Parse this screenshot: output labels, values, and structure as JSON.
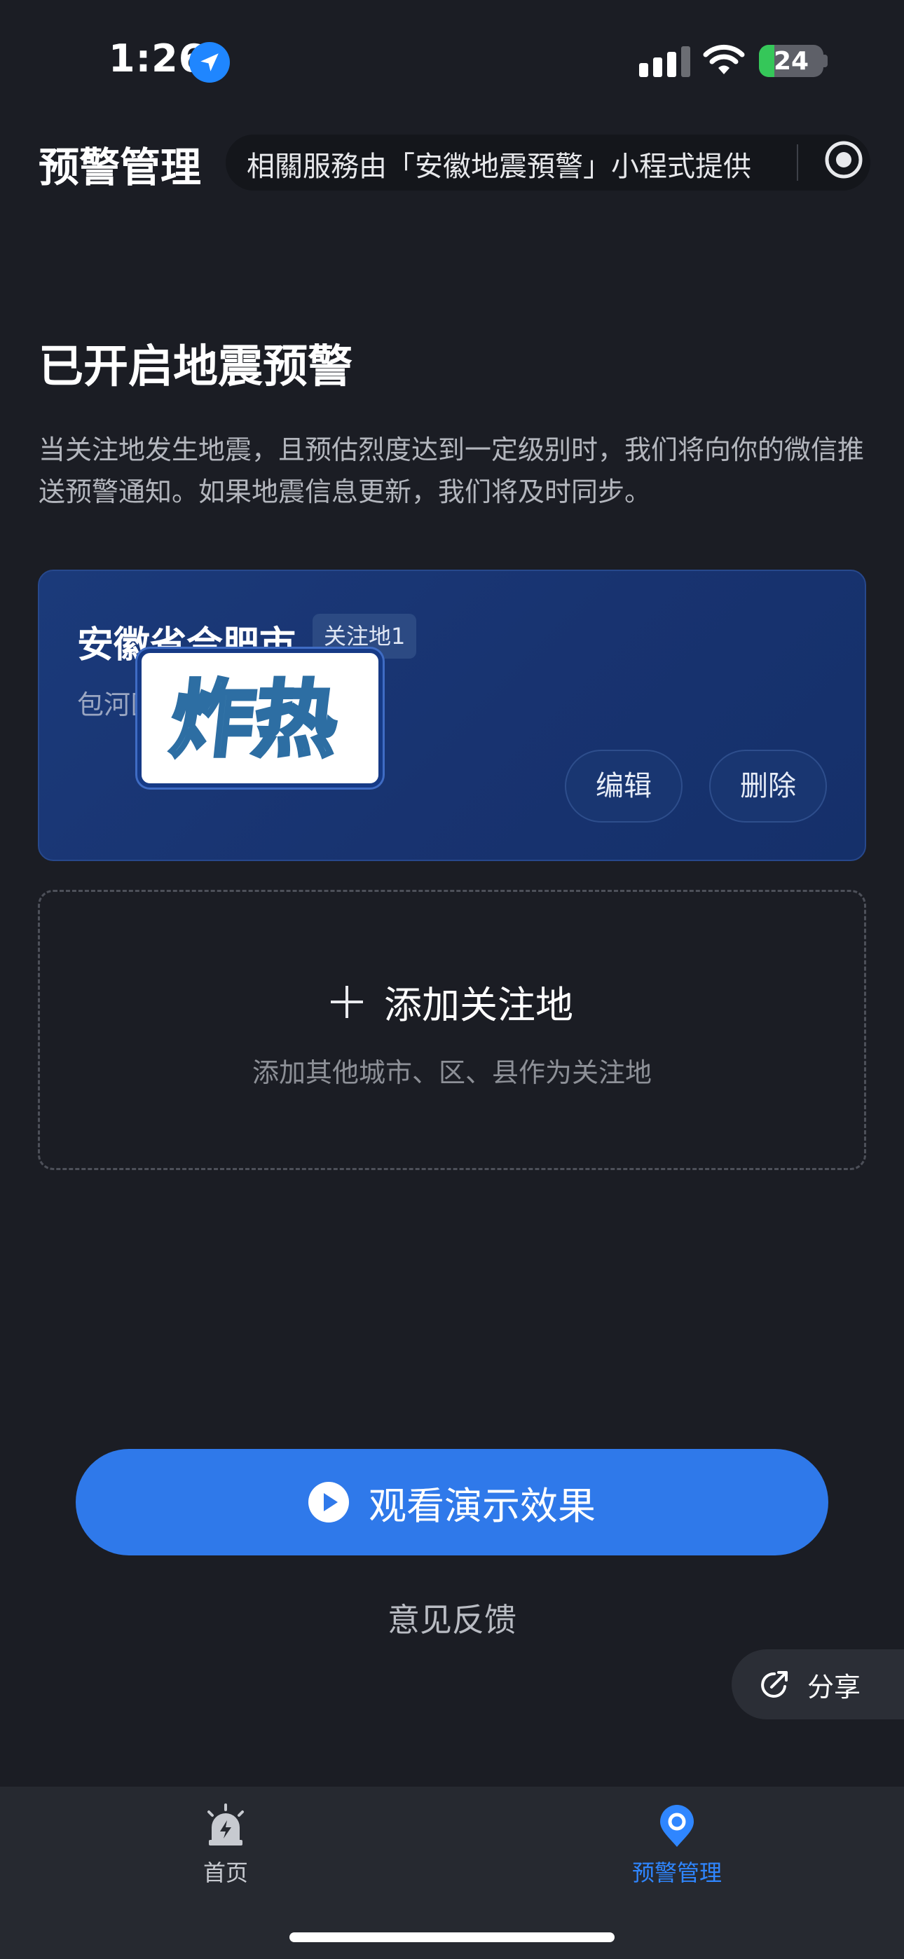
{
  "status_bar": {
    "time": "1:26",
    "battery_level": "24",
    "battery_percent": 24,
    "icons": [
      "location-arrow-icon",
      "signal-icon",
      "wifi-icon",
      "battery-charging-icon"
    ]
  },
  "header": {
    "title": "预警管理",
    "notice": "相關服務由「安徽地震預警」小程式提供",
    "menu_icon": "target-icon"
  },
  "section": {
    "title": "已开启地震预警",
    "description": "当关注地发生地震，且预估烈度达到一定级别时，我们将向你的微信推送预警通知。如果地震信息更新，我们将及时同步。"
  },
  "location_card": {
    "name": "安徽省合肥市",
    "badge": "关注地1",
    "subtitle": "包河区",
    "sticker_text": "炸热",
    "edit_label": "编辑",
    "delete_label": "删除"
  },
  "add_card": {
    "label": "添加关注地",
    "hint": "添加其他城市、区、县作为关注地"
  },
  "actions": {
    "demo_label": "观看演示效果",
    "feedback_label": "意见反馈",
    "share_label": "分享"
  },
  "tabbar": {
    "items": [
      {
        "label": "首页",
        "icon": "alarm-siren-icon",
        "active": false
      },
      {
        "label": "预警管理",
        "icon": "location-pin-icon",
        "active": true
      }
    ]
  },
  "colors": {
    "background": "#1b1d24",
    "accent": "#2f79ea",
    "card": "#183370",
    "active_tab": "#2f86ff"
  }
}
